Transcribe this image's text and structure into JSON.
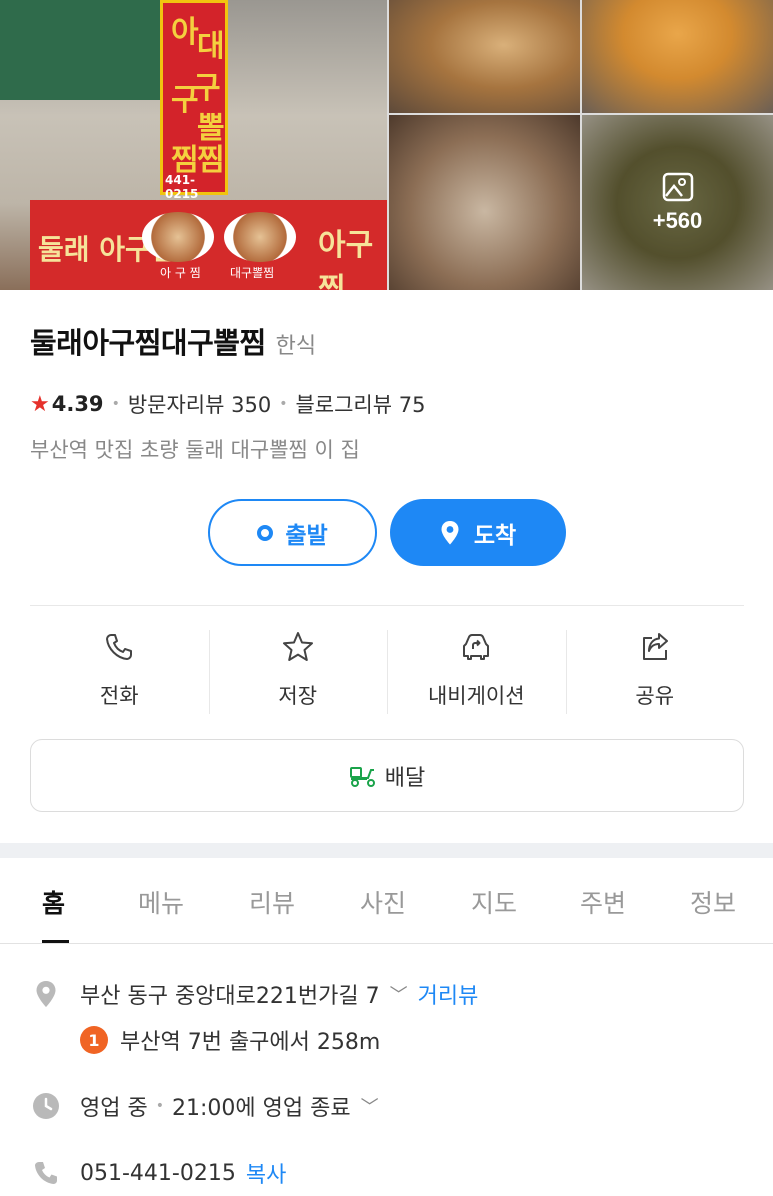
{
  "photos": {
    "more_count": "+560",
    "building_sign": {
      "vertical": [
        "아",
        "대",
        "구",
        "뽈",
        "찜",
        "찜"
      ],
      "phone": "441-0215",
      "left_text": "둘래 아구찜",
      "caption1": "아 구 찜",
      "caption2": "대구뽈찜",
      "right_text": "아구찜"
    }
  },
  "place": {
    "name": "둘래아구찜대구뽈찜",
    "category": "한식",
    "rating": "4.39",
    "visitor_reviews": "방문자리뷰 350",
    "blog_reviews": "블로그리뷰 75",
    "description": "부산역 맛집 초량 둘래 대구뽈찜 이 집"
  },
  "route": {
    "start_label": "출발",
    "end_label": "도착"
  },
  "actions": {
    "call": "전화",
    "save": "저장",
    "navigation": "내비게이션",
    "share": "공유"
  },
  "delivery_label": "배달",
  "tabs": [
    "홈",
    "메뉴",
    "리뷰",
    "사진",
    "지도",
    "주변",
    "정보"
  ],
  "info": {
    "address": "부산 동구 중앙대로221번가길 7",
    "street_view": "거리뷰",
    "subway_line": "1",
    "subway_direction": "부산역 7번 출구에서 258m",
    "open_status": "영업 중",
    "close_time": "21:00에 영업 종료",
    "phone": "051-441-0215",
    "copy": "복사"
  },
  "colors": {
    "accent": "#1e88f5",
    "star": "#e5312b",
    "subway_line_1": "#f06424",
    "delivery_icon": "#1aa34a"
  }
}
